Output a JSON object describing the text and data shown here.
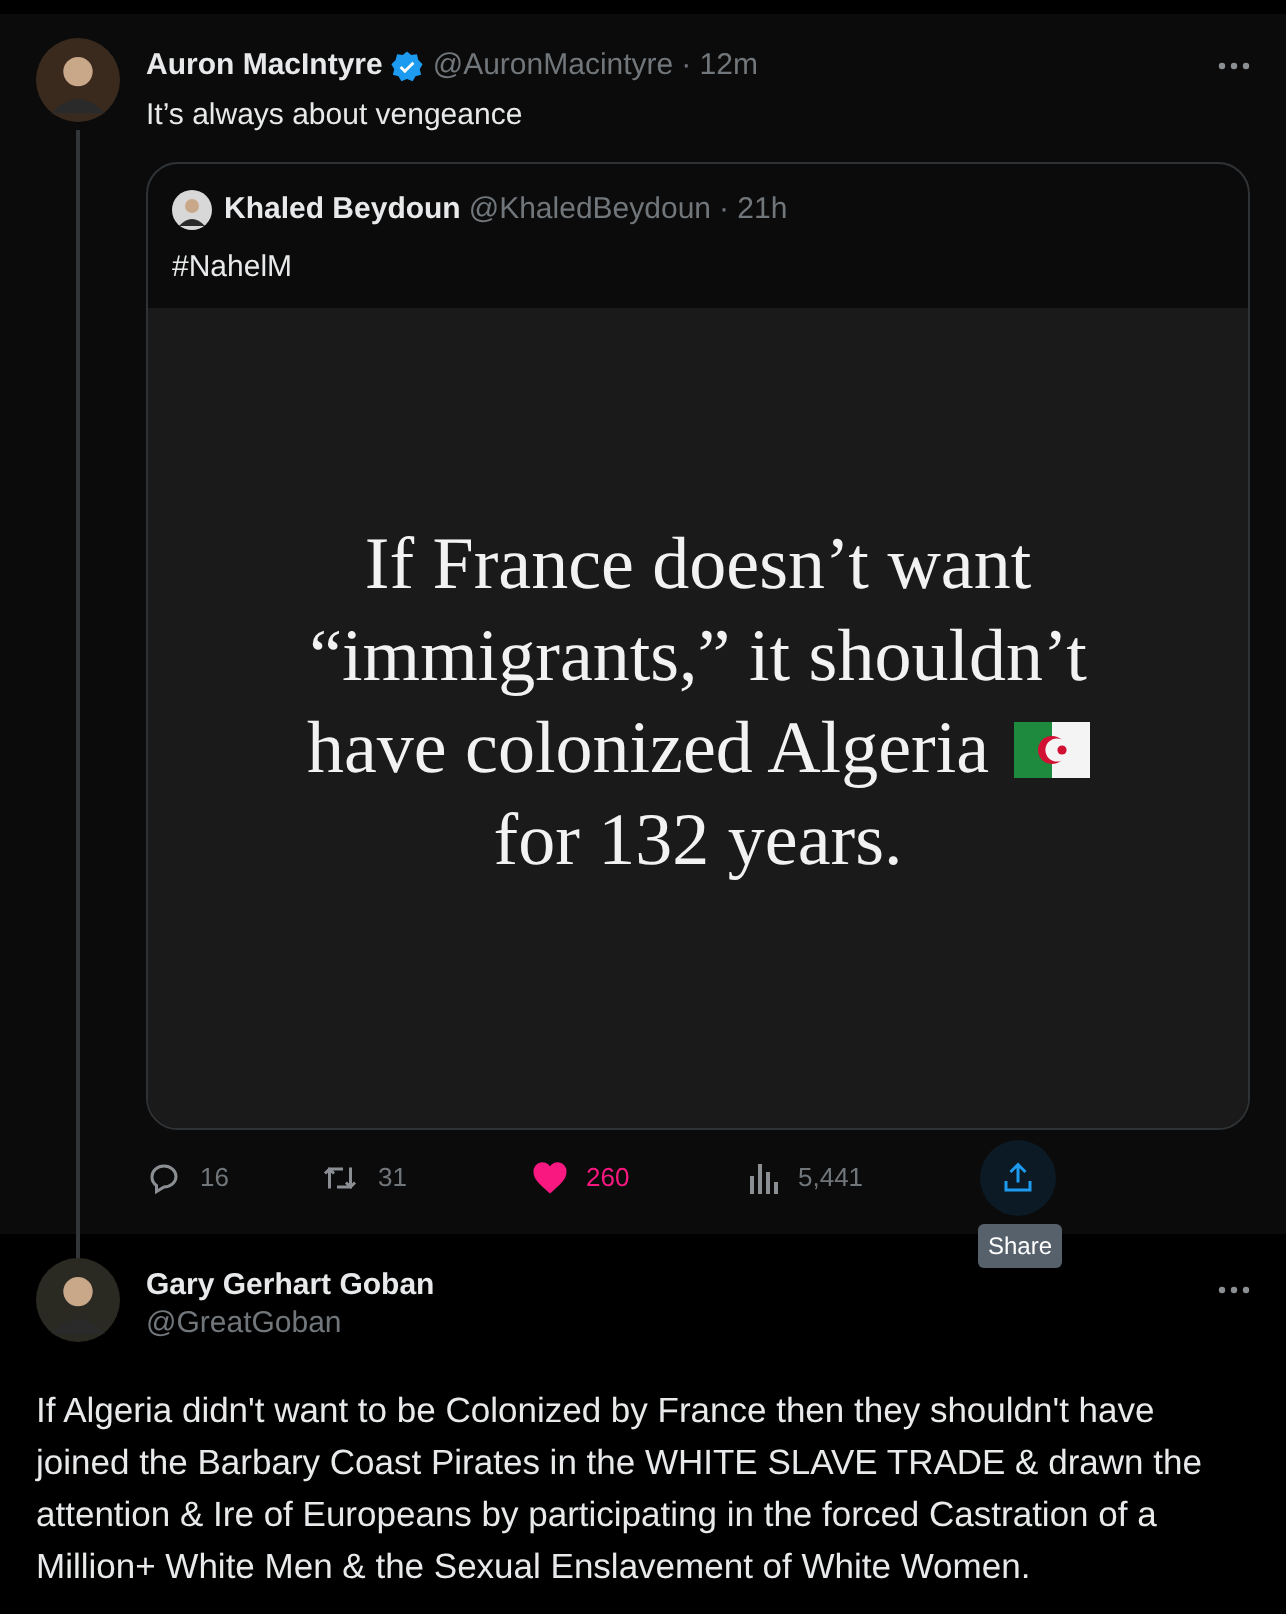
{
  "tweet": {
    "author": {
      "name": "Auron MacIntyre",
      "handle": "@AuronMacintyre",
      "time": "· 12m",
      "verified": true
    },
    "text": "It’s always about vengeance",
    "quote": {
      "author": {
        "name": "Khaled Beydoun",
        "handle": "@KhaledBeydoun",
        "time": "· 21h"
      },
      "text": "#NahelM",
      "image": {
        "lines": [
          "If France doesn’t want",
          "“immigrants,” it shouldn’t",
          "have colonized Algeria",
          "for 132 years."
        ]
      }
    },
    "actions": [
      {
        "kind": "reply",
        "count": "16",
        "highlighted": false
      },
      {
        "kind": "retweet",
        "count": "31",
        "highlighted": false
      },
      {
        "kind": "like",
        "count": "260",
        "highlighted": true
      },
      {
        "kind": "views",
        "count": "5,441",
        "highlighted": false
      },
      {
        "kind": "share",
        "highlighted": true
      }
    ],
    "tooltip": "Share"
  },
  "reply": {
    "author": {
      "name": "Gary Gerhart Goban",
      "handle": "@GreatGoban"
    },
    "text": "If Algeria didn't want to be Colonized by France then they shouldn't have joined the Barbary Coast Pirates in the WHITE SLAVE TRADE & drawn the attention & Ire of Europeans by participating in the forced Castration of a Million+ White Men & the Sexual Enslavement of White Women."
  }
}
